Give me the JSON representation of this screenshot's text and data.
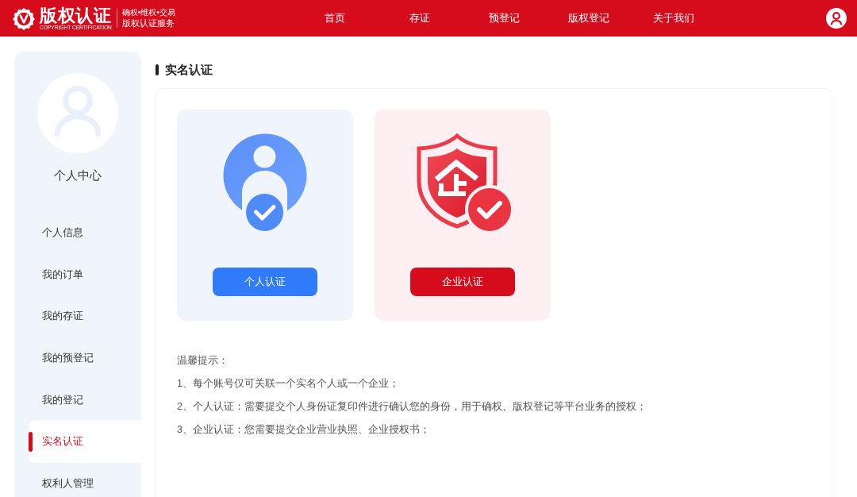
{
  "header": {
    "logo": {
      "title": "版权认证",
      "subtitle": "COPYRIGHT CERTIFICATION",
      "tagline": "确权•维权•交易",
      "service": "版权认证服务"
    },
    "nav": [
      {
        "label": "首页"
      },
      {
        "label": "存证"
      },
      {
        "label": "预登记"
      },
      {
        "label": "版权登记"
      },
      {
        "label": "关于我们"
      }
    ]
  },
  "sidebar": {
    "title": "个人中心",
    "items": [
      {
        "label": "个人信息",
        "selected": false
      },
      {
        "label": "我的订单",
        "selected": false
      },
      {
        "label": "我的存证",
        "selected": false
      },
      {
        "label": "我的预登记",
        "selected": false
      },
      {
        "label": "我的登记",
        "selected": false
      },
      {
        "label": "实名认证",
        "selected": true
      },
      {
        "label": "权利人管理",
        "selected": false
      }
    ]
  },
  "main": {
    "title": "实名认证",
    "options": [
      {
        "kind": "personal",
        "button": "个人认证"
      },
      {
        "kind": "enterprise",
        "button": "企业认证"
      }
    ],
    "tips": {
      "heading": "温馨提示：",
      "lines": [
        "1、每个账号仅可关联一个实名个人或一个企业；",
        "2、个人认证：需要提交个人身份证复印件进行确认您的身份，用于确权、版权登记等平台业务的授权；",
        "3、企业认证：您需要提交企业营业执照、企业授权书；"
      ]
    }
  }
}
